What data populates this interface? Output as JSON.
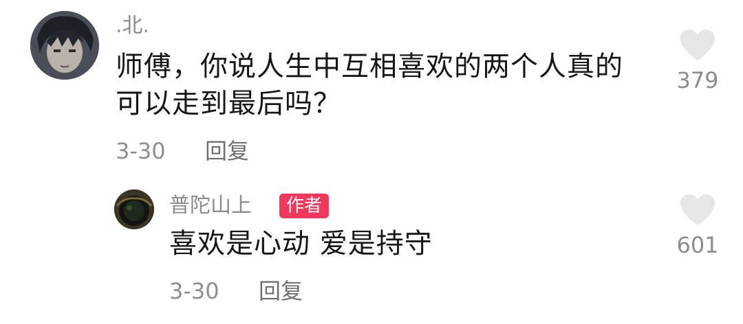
{
  "comment": {
    "username": ".北.",
    "text_line1": "师傅，你说人生中互相喜欢的两个人真的",
    "text_line2": "可以走到最后吗？",
    "date": "3-30",
    "reply_label": "回复",
    "like_count": "379",
    "avatar_icon": "anime-avatar-icon"
  },
  "reply": {
    "username": "普陀山上",
    "badge": "作者",
    "text": "喜欢是心动 爱是持守",
    "date": "3-30",
    "reply_label": "回复",
    "like_count": "601",
    "avatar_icon": "well-avatar-icon"
  },
  "colors": {
    "badge": "#f1385c",
    "heart": "#e6e6e6",
    "secondary_text": "#8a8a8a"
  }
}
